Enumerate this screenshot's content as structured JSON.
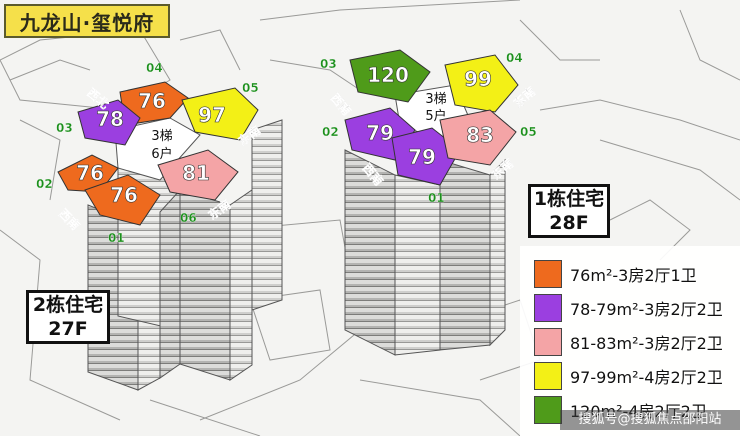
{
  "title": "九龙山·玺悦府",
  "colors": {
    "orange": "#ee6a1e",
    "purple": "#9b3fe0",
    "pink": "#f4a4a6",
    "yellow": "#f3f016",
    "green": "#4f9b1a"
  },
  "building1": {
    "label_line1": "1栋住宅",
    "label_line2": "28F",
    "core_label_1": "3梯",
    "core_label_2": "5户",
    "units": [
      {
        "value": "120",
        "id": "03",
        "color": "green"
      },
      {
        "value": "99",
        "id": "04",
        "color": "yellow"
      },
      {
        "value": "79",
        "id": "02",
        "color": "purple"
      },
      {
        "value": "79",
        "id": "01",
        "color": "purple"
      },
      {
        "value": "83",
        "id": "05",
        "color": "pink"
      }
    ],
    "dirs": {
      "west_south_a": "西南",
      "east_south_a": "东南",
      "west_south_b": "西南",
      "east_south_b": "东南"
    }
  },
  "building2": {
    "label_line1": "2栋住宅",
    "label_line2": "27F",
    "core_label_1": "3梯",
    "core_label_2": "6户",
    "units": [
      {
        "value": "76",
        "id": "04",
        "color": "orange"
      },
      {
        "value": "97",
        "id": "05",
        "color": "yellow"
      },
      {
        "value": "78",
        "id": "03",
        "color": "purple"
      },
      {
        "value": "76",
        "id": "02",
        "color": "orange"
      },
      {
        "value": "76",
        "id": "01",
        "color": "orange"
      },
      {
        "value": "81",
        "id": "06",
        "color": "pink"
      }
    ],
    "dirs": {
      "west_north": "西北",
      "east_south_a": "东南",
      "west_south": "西南",
      "east_south_b": "东南"
    }
  },
  "legend": [
    {
      "color": "orange",
      "text": "76m²-3房2厅1卫"
    },
    {
      "color": "purple",
      "text": "78-79m²-3房2厅2卫"
    },
    {
      "color": "pink",
      "text": "81-83m²-3房2厅2卫"
    },
    {
      "color": "yellow",
      "text": "97-99m²-4房2厅2卫"
    },
    {
      "color": "green",
      "text": "120m²-4房2厅2卫"
    }
  ],
  "watermark": "搜狐号@搜狐焦点邵阳站"
}
